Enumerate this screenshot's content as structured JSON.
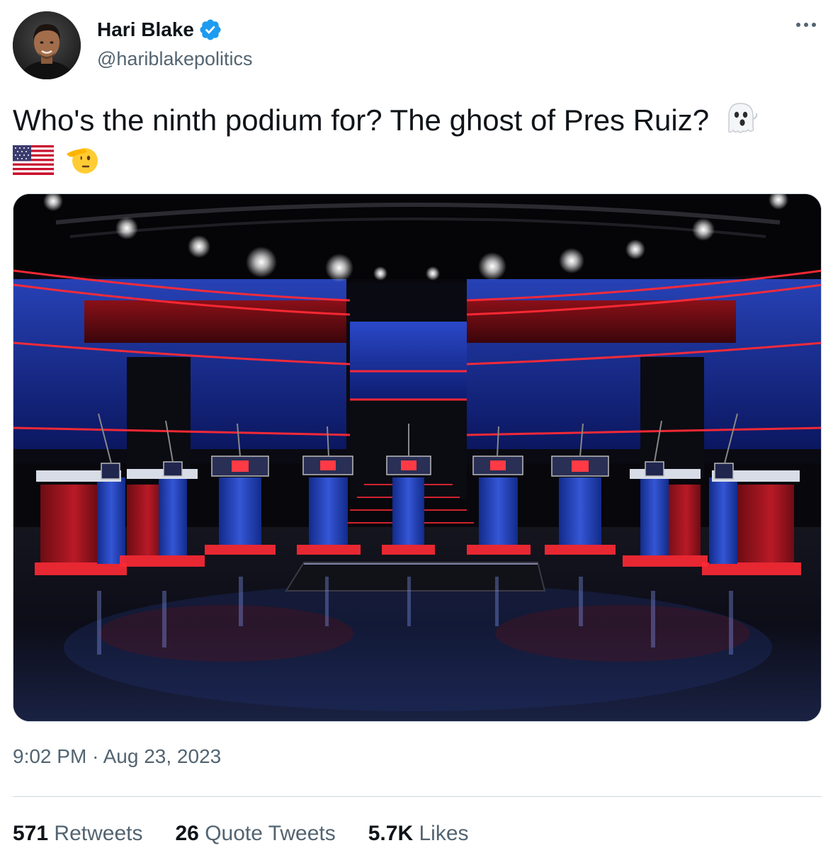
{
  "author": {
    "name": "Hari Blake",
    "handle": "@hariblakepolitics",
    "verified": true,
    "avatar_icon": "profile-photo"
  },
  "tweet": {
    "text": "Who's the ninth podium for? The ghost of Pres Ruiz?",
    "emojis": [
      "ghost-emoji",
      "us-flag-emoji",
      "saluting-face-emoji"
    ]
  },
  "media": {
    "description_icon": "debate-stage-photo",
    "podium_count": 9
  },
  "timestamp": {
    "time": "9:02 PM",
    "separator": "·",
    "date": "Aug 23, 2023"
  },
  "stats": {
    "retweets_count": "571",
    "retweets_label": "Retweets",
    "quotes_count": "26",
    "quotes_label": "Quote Tweets",
    "likes_count": "5.7K",
    "likes_label": "Likes"
  },
  "colors": {
    "text_primary": "#0f1419",
    "text_secondary": "#536471",
    "verified_blue": "#1d9bf0",
    "divider": "#cfd9de",
    "stage_red": "#d2202a",
    "stage_blue": "#1f3aa8"
  }
}
